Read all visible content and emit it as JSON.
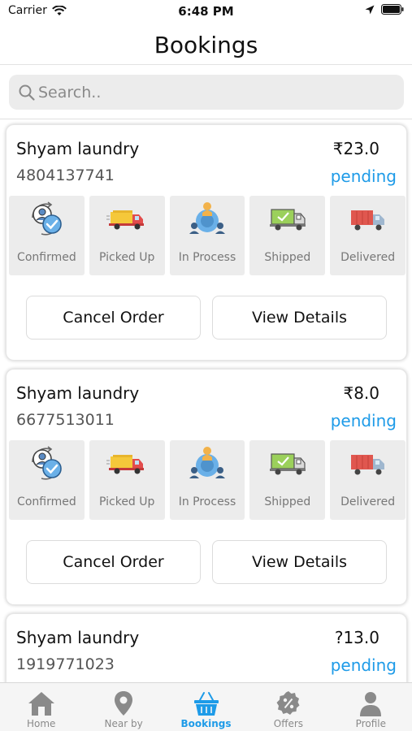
{
  "status_bar": {
    "carrier": "Carrier",
    "time": "6:48 PM"
  },
  "header": {
    "title": "Bookings"
  },
  "search": {
    "placeholder": "Search.."
  },
  "steps": {
    "confirmed": "Confirmed",
    "picked_up": "Picked Up",
    "in_process": "In  Process",
    "shipped": "Shipped",
    "delivered": "Delivered"
  },
  "buttons": {
    "cancel": "Cancel Order",
    "view": "View Details"
  },
  "bookings": [
    {
      "shop": "Shyam laundry",
      "phone": "4804137741",
      "price": "₹23.0",
      "status": "pending"
    },
    {
      "shop": "Shyam laundry",
      "phone": "6677513011",
      "price": "₹8.0",
      "status": "pending"
    },
    {
      "shop": "Shyam laundry",
      "phone": "1919771023",
      "price": "?13.0",
      "status": "pending"
    }
  ],
  "tabbar": {
    "home": "Home",
    "nearby": "Near by",
    "bookings": "Bookings",
    "offers": "Offers",
    "profile": "Profile"
  },
  "colors": {
    "accent": "#1e9be8",
    "tile": "#ececec",
    "tab_inactive": "#8a8a8a"
  }
}
